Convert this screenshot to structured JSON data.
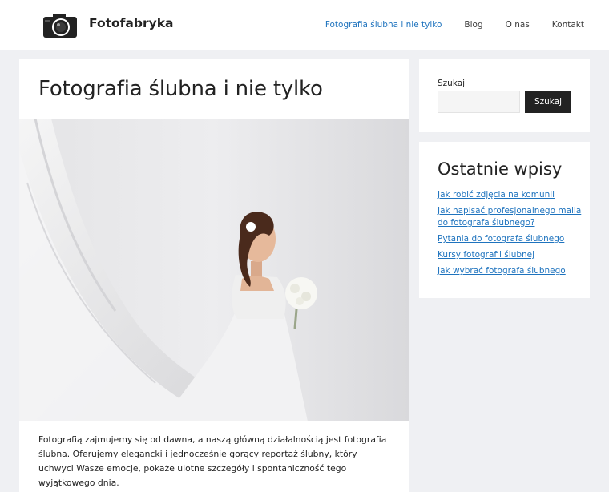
{
  "header": {
    "site_title": "Fotofabryka",
    "logo_icon": "camera-icon",
    "nav": [
      {
        "label": "Fotografia ślubna i nie tylko",
        "current": true
      },
      {
        "label": "Blog",
        "current": false
      },
      {
        "label": "O nas",
        "current": false
      },
      {
        "label": "Kontakt",
        "current": false
      }
    ]
  },
  "main": {
    "title": "Fotografia ślubna i nie tylko",
    "intro": "Fotografią zajmujemy się od dawna, a naszą główną działalnością jest fotografia ślubna. Oferujemy elegancki i jednocześnie gorący reportaż ślubny, który uchwyci Wasze emocje, pokaże ulotne szczegóły i spontaniczność tego wyjątkowego dnia."
  },
  "sidebar": {
    "search": {
      "label": "Szukaj",
      "input_value": "",
      "button_label": "Szukaj"
    },
    "recent": {
      "title": "Ostatnie wpisy",
      "items": [
        "Jak robić zdjęcia na komunii",
        "Jak napisać profesjonalnego maila do fotografa ślubnego?",
        "Pytania do fotografa ślubnego",
        "Kursy fotografii ślubnej",
        "Jak wybrać fotografa ślubnego"
      ]
    }
  },
  "colors": {
    "background": "#eff0f3",
    "link": "#1e73be",
    "button": "#222222"
  }
}
